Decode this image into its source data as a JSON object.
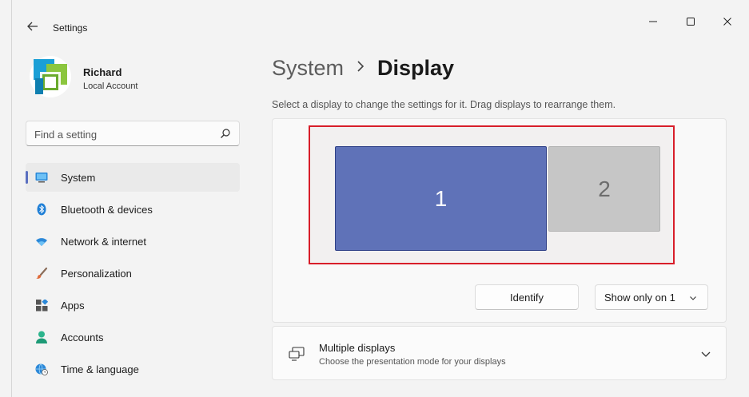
{
  "window": {
    "app_title": "Settings"
  },
  "profile": {
    "name": "Richard",
    "account_type": "Local Account"
  },
  "search": {
    "placeholder": "Find a setting"
  },
  "sidebar": {
    "items": [
      {
        "label": "System",
        "icon": "system-monitor-icon",
        "active": true
      },
      {
        "label": "Bluetooth & devices",
        "icon": "bluetooth-icon",
        "active": false
      },
      {
        "label": "Network & internet",
        "icon": "wifi-icon",
        "active": false
      },
      {
        "label": "Personalization",
        "icon": "brush-icon",
        "active": false
      },
      {
        "label": "Apps",
        "icon": "apps-icon",
        "active": false
      },
      {
        "label": "Accounts",
        "icon": "person-icon",
        "active": false
      },
      {
        "label": "Time & language",
        "icon": "globe-clock-icon",
        "active": false
      }
    ]
  },
  "header": {
    "parent": "System",
    "current": "Display"
  },
  "main": {
    "hint": "Select a display to change the settings for it. Drag displays to rearrange them.",
    "displays": [
      {
        "number": "1",
        "selected": true
      },
      {
        "number": "2",
        "selected": false
      }
    ],
    "identify_label": "Identify",
    "mode_dropdown": "Show only on 1",
    "multiple_displays": {
      "title": "Multiple displays",
      "subtitle": "Choose the presentation mode for your displays"
    }
  },
  "colors": {
    "accent": "#5a6fc0",
    "selected_display": "#5f72b8",
    "unselected_display": "#c6c6c6",
    "highlight_box": "#d81e2a"
  }
}
